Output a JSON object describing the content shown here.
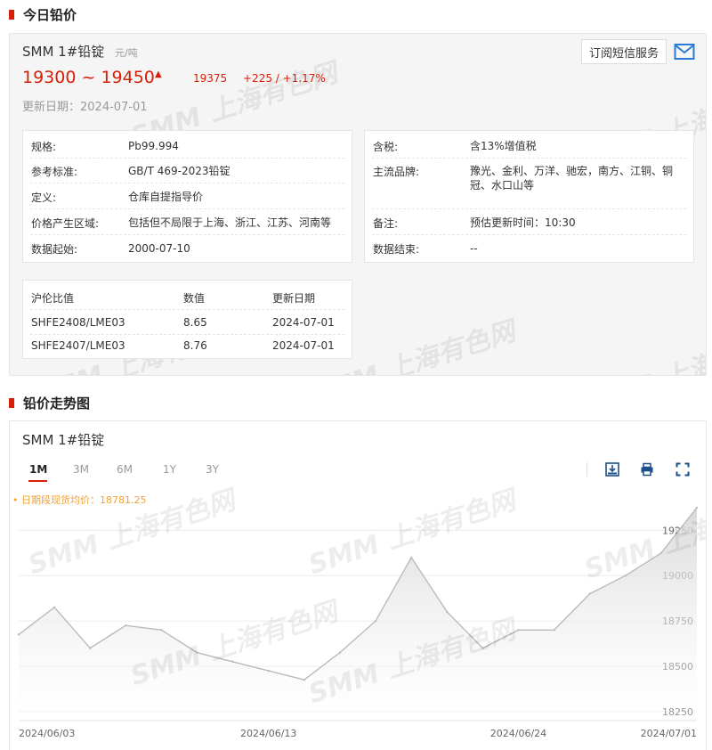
{
  "sections": {
    "today_title": "今日铅价",
    "trend_title": "铅价走势图"
  },
  "product": {
    "name": "SMM 1#铅锭",
    "unit": "元/吨",
    "price_range": "19300 ~ 19450",
    "avg": "19375",
    "change": "+225 / +1.17%",
    "update_label": "更新日期：2024-07-01"
  },
  "subscribe": {
    "label": "订阅短信服务",
    "icon": "mail-icon"
  },
  "info_left": [
    {
      "key": "规格:",
      "value": "Pb99.994"
    },
    {
      "key": "参考标准:",
      "value": "GB/T 469-2023铅锭"
    },
    {
      "key": "定义:",
      "value": "仓库自提指导价"
    },
    {
      "key": "价格产生区域:",
      "value": "包括但不局限于上海、浙江、江苏、河南等"
    },
    {
      "key": "数据起始:",
      "value": "2000-07-10"
    }
  ],
  "info_right": [
    {
      "key": "含税:",
      "value": "含13%增值税"
    },
    {
      "key": "主流品牌:",
      "value": "豫光、金利、万洋、驰宏，南方、江铜、铜冠、水口山等"
    },
    {
      "key": "备注:",
      "value": "预估更新时间：10:30"
    },
    {
      "key": "数据结束:",
      "value": "--"
    }
  ],
  "ratio_table": {
    "headers": [
      "沪伦比值",
      "数值",
      "更新日期"
    ],
    "rows": [
      [
        "SHFE2408/LME03",
        "8.65",
        "2024-07-01"
      ],
      [
        "SHFE2407/LME03",
        "8.76",
        "2024-07-01"
      ]
    ]
  },
  "watermark": "SMM 上海有色网",
  "chart_panel": {
    "title": "SMM 1#铅锭",
    "tabs": [
      "1M",
      "3M",
      "6M",
      "1Y",
      "3Y"
    ],
    "active_tab": "1M",
    "avg_note": "• 日期段现货均价：18781.25",
    "tool_icons": [
      "download-icon",
      "print-icon",
      "fullscreen-icon"
    ]
  },
  "colors": {
    "accent": "#d81e06",
    "note": "#f0a03a",
    "line": "#bbbbbb"
  },
  "chart_data": {
    "type": "area",
    "title": "",
    "xlabel": "",
    "ylabel": "",
    "x_ticks": [
      "2024/06/03",
      "2024/06/13",
      "2024/06/24",
      "2024/07/01"
    ],
    "y_ticks": [
      18250,
      18500,
      18750,
      19000,
      19250
    ],
    "ylim": [
      18200,
      19360
    ],
    "grid": true,
    "series": [
      {
        "x": [
          "2024/06/03",
          "2024/06/04",
          "2024/06/05",
          "2024/06/06",
          "2024/06/07",
          "2024/06/11",
          "2024/06/12",
          "2024/06/13",
          "2024/06/14",
          "2024/06/17",
          "2024/06/18",
          "2024/06/19",
          "2024/06/20",
          "2024/06/21",
          "2024/06/24",
          "2024/06/25",
          "2024/06/26",
          "2024/06/27",
          "2024/06/28",
          "2024/07/01"
        ],
        "values": [
          18675,
          18825,
          18600,
          18725,
          18700,
          18575,
          18525,
          18475,
          18425,
          18575,
          18750,
          19100,
          18800,
          18600,
          18700,
          18700,
          18900,
          19000,
          19125,
          19375
        ]
      }
    ]
  }
}
